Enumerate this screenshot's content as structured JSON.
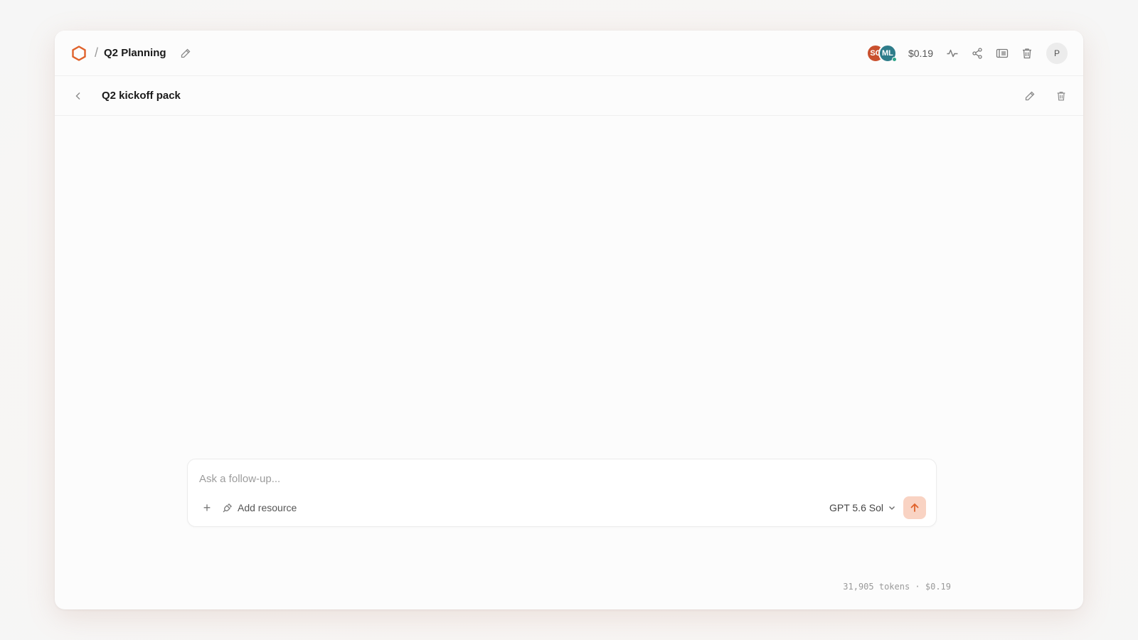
{
  "header": {
    "project_title": "Q2 Planning",
    "separator": "/",
    "collaborators": [
      {
        "initials": "SC",
        "color": "#c9502e"
      },
      {
        "initials": "ML",
        "color": "#2e7c8a"
      }
    ],
    "cost": "$0.19",
    "user_initial": "P",
    "icons": [
      "logo-hexagon-icon",
      "edit-icon",
      "activity-icon",
      "share-icon",
      "panel-icon",
      "trash-icon"
    ]
  },
  "subheader": {
    "title": "Q2 kickoff pack",
    "icons": [
      "back-chevron-icon",
      "edit-icon",
      "trash-icon"
    ]
  },
  "composer": {
    "placeholder": "Ask a follow-up...",
    "plus_label": "+",
    "add_resource_label": "Add resource",
    "model_label": "GPT 5.6 Sol"
  },
  "usage": {
    "text": "31,905 tokens · $0.19"
  },
  "colors": {
    "accent": "#e0622b",
    "send_button_bg": "#f9d3c3"
  }
}
